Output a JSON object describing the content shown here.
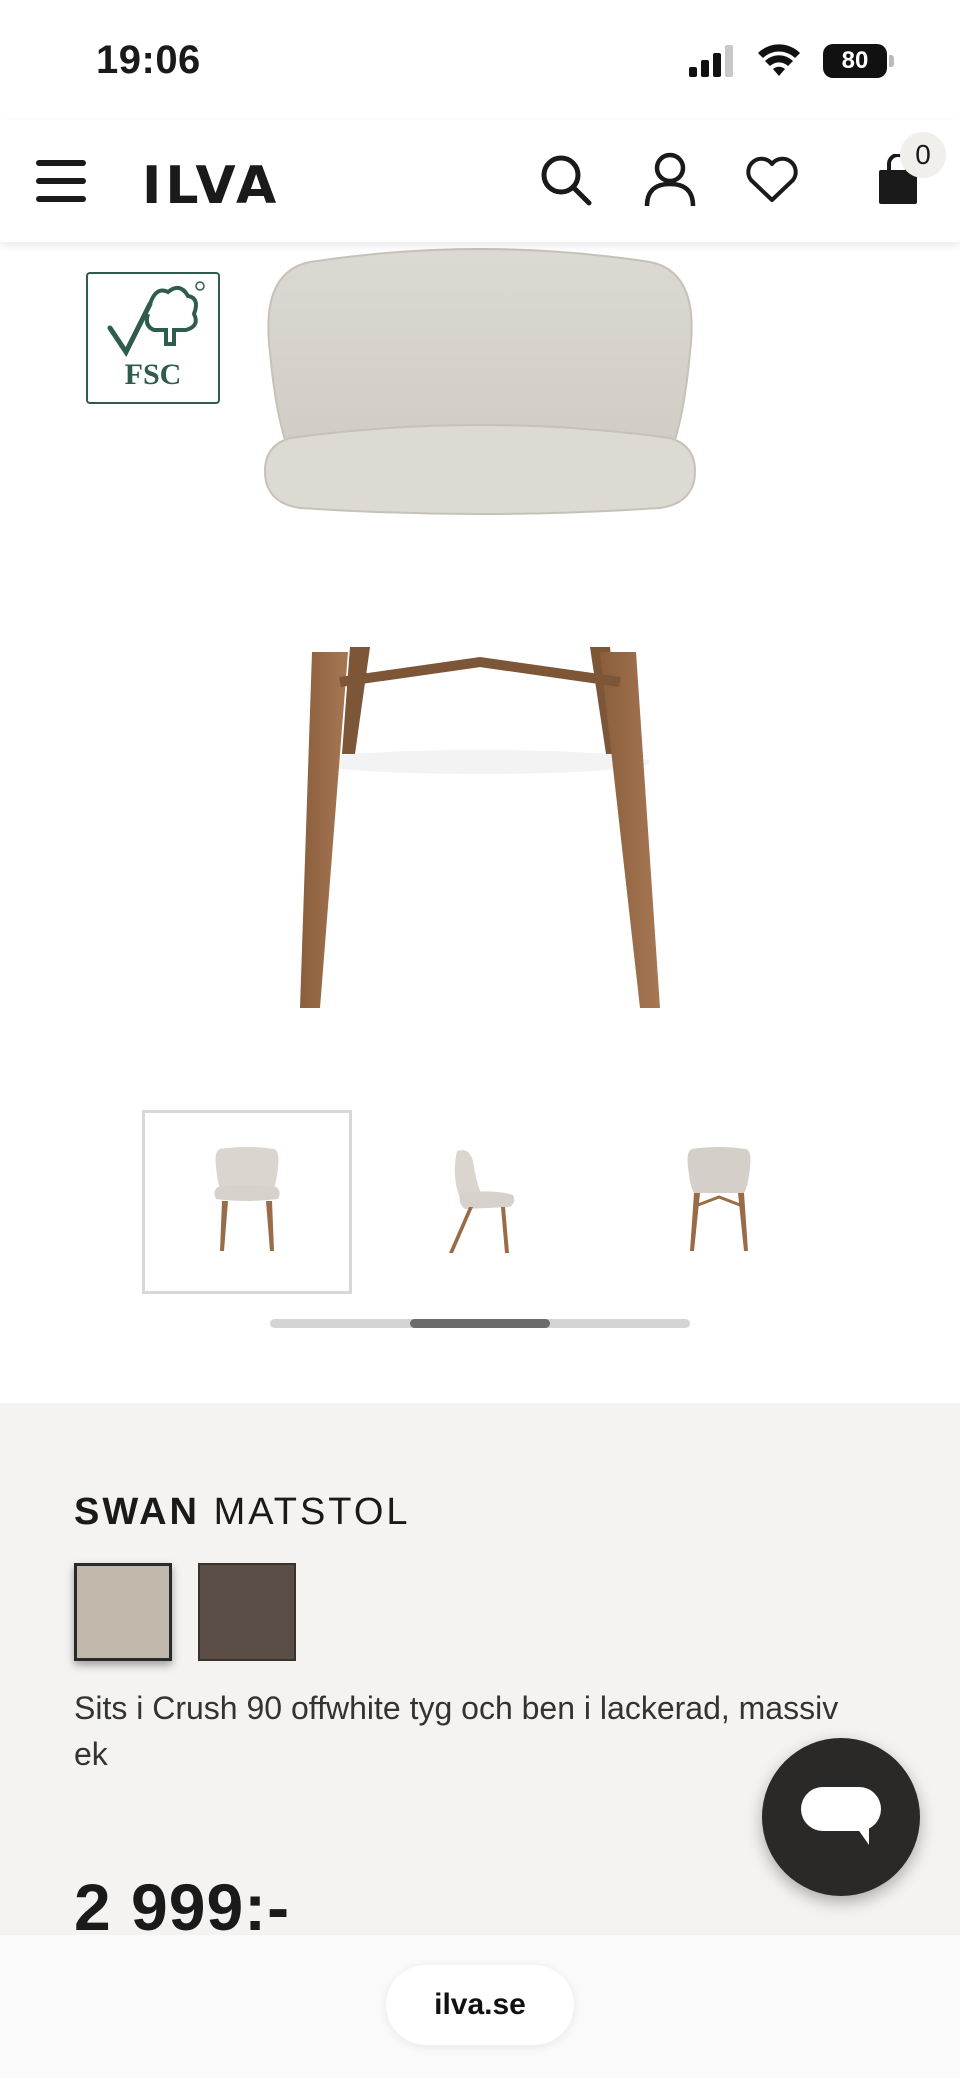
{
  "status_bar": {
    "time": "19:06",
    "battery": "80"
  },
  "header": {
    "logo": "ILVA",
    "cart_count": "0"
  },
  "product": {
    "certification_badge": "FSC",
    "brand": "SWAN",
    "type": "MATSTOL",
    "swatches": [
      {
        "color": "#bfb8ab",
        "selected": true
      },
      {
        "color": "#5a4d45",
        "selected": false
      }
    ],
    "description": "Sits i Crush 90 offwhite tyg och ben i lackerad, massiv ek",
    "price": "2 999:-"
  },
  "gallery": {
    "thumbnail_count": 3,
    "active_index": 0
  },
  "browser": {
    "url": "ilva.se"
  }
}
